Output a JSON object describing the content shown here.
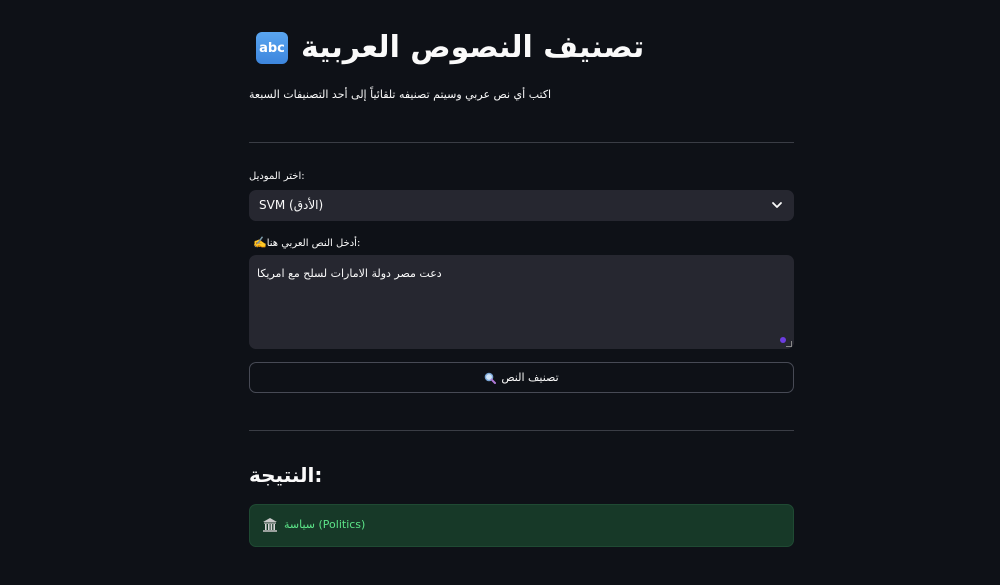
{
  "header": {
    "title": "تصنيف النصوص العربية",
    "title_emoji": "abc",
    "subtitle": "اكتب أي نص عربي وسيتم تصنيفه تلقائياً إلى أحد التصنيفات السبعة"
  },
  "model_select": {
    "label": "اختر الموديل:",
    "value": "SVM (الأدق)",
    "icon": "chevron-down-icon"
  },
  "text_input": {
    "label": "أدخل النص العربي هنا:",
    "label_emoji": "✍️",
    "value": "دعت مصر  دولة الامارات لسلح مع امريكا"
  },
  "classify_button": {
    "label": "تصنيف النص",
    "icon": "magnifier-icon"
  },
  "result": {
    "heading": "النتيجة:",
    "icon": "classical-building-icon",
    "text": "سياسة (Politics)"
  },
  "colors": {
    "background": "#0e1117",
    "input_bg": "#262730",
    "success_bg": "#173928",
    "success_text": "#5ce488",
    "accent": "#6c3ce0"
  }
}
